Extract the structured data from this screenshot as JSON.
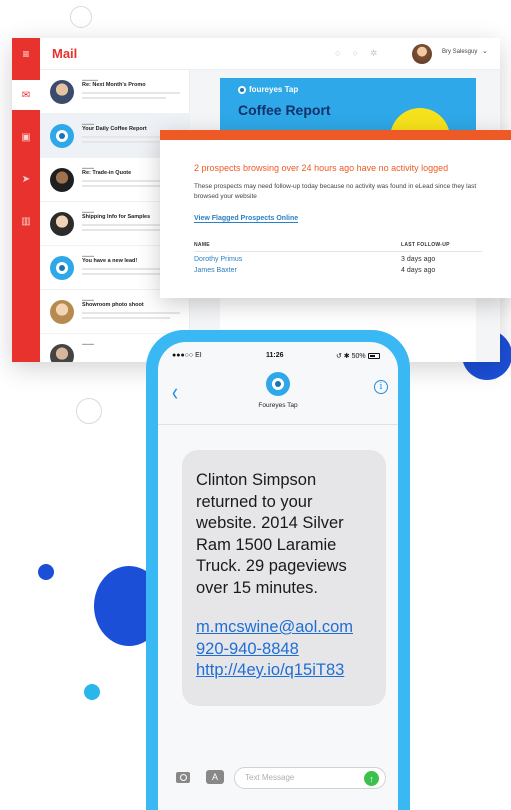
{
  "mail": {
    "menu_icon": "≡",
    "title": "Mail",
    "user_name": "Bry Salesguy",
    "items": [
      {
        "subject": "Re: Next Month's Promo"
      },
      {
        "subject": "Your Daily Coffee Report"
      },
      {
        "subject": "Re: Trade-in Quote"
      },
      {
        "subject": "Shipping Info for Samples"
      },
      {
        "subject": "You have a new lead!"
      },
      {
        "subject": "Showroom photo shoot"
      }
    ],
    "coffee_brand": "foureyes Tap",
    "coffee_title": "Coffee Report"
  },
  "notification": {
    "title": "2 prospects browsing over 24 hours ago have no activity logged",
    "description": "These prospects may need follow-up today because no activity was found in eLead since they last browsed your website",
    "link": "View Flagged Prospects Online",
    "col_name": "NAME",
    "col_followup": "LAST FOLLOW-UP",
    "rows": [
      {
        "name": "Dorothy Primus",
        "followup": "3 days ago"
      },
      {
        "name": "James Baxter",
        "followup": "4 days ago"
      }
    ]
  },
  "phone": {
    "carrier": "●●●○○ EI",
    "time": "11:26",
    "battery": "50%",
    "contact": "Foureyes Tap",
    "message_lines": [
      "Clinton Simpson",
      "returned to your",
      "website. 2014 Silver",
      "Ram 1500 Laramie",
      "Truck. 29 pageviews",
      "over 15 minutes."
    ],
    "email": "m.mcswine@aol.com",
    "phone_number": "920-940-8848",
    "url": "http://4ey.io/q15iT83",
    "input_placeholder": "Text Message"
  },
  "colors": {
    "mail_red": "#e8322d",
    "notify_orange": "#ee5a25",
    "phone_blue": "#3ab8f3",
    "link_blue": "#1f6ed6",
    "send_green": "#3cc14f"
  }
}
